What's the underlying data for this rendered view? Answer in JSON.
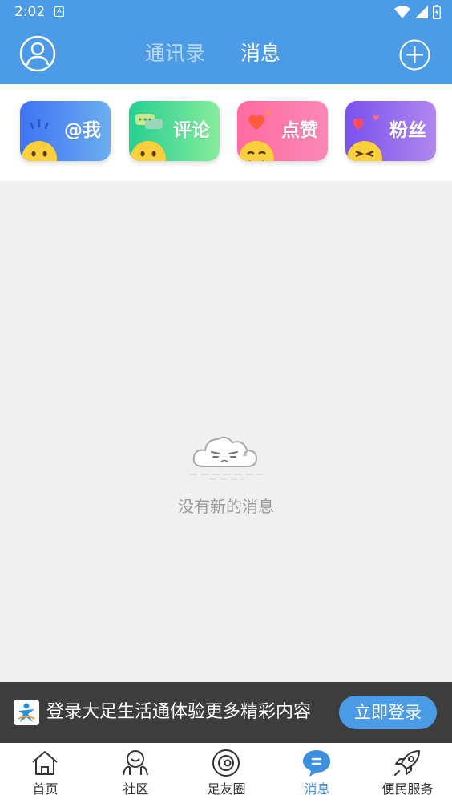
{
  "status_bar": {
    "time": "2:02",
    "notification_glyph": "A"
  },
  "header": {
    "tabs": [
      {
        "label": "通讯录",
        "active": false
      },
      {
        "label": "消息",
        "active": true
      }
    ],
    "avatar_icon": "user-circle-icon",
    "add_icon": "plus-circle-icon"
  },
  "quick_cards": [
    {
      "label": "@我",
      "color": "#4a86f1"
    },
    {
      "label": "评论",
      "color": "#3fd996"
    },
    {
      "label": "点赞",
      "color": "#fd72a6"
    },
    {
      "label": "粉丝",
      "color": "#9466ef"
    }
  ],
  "empty_state": {
    "message": "没有新的消息"
  },
  "login_banner": {
    "text": "登录大足生活通体验更多精彩内容",
    "button_label": "立即登录"
  },
  "bottom_nav": [
    {
      "label": "首页",
      "icon": "home-icon",
      "active": false
    },
    {
      "label": "社区",
      "icon": "community-icon",
      "active": false
    },
    {
      "label": "足友圈",
      "icon": "circle-icon",
      "active": false
    },
    {
      "label": "消息",
      "icon": "message-icon",
      "active": true
    },
    {
      "label": "便民服务",
      "icon": "rocket-icon",
      "active": false
    }
  ],
  "colors": {
    "primary": "#4b9be6",
    "active_nav": "#3d8fe0",
    "banner_bg": "#3d3d3d"
  }
}
